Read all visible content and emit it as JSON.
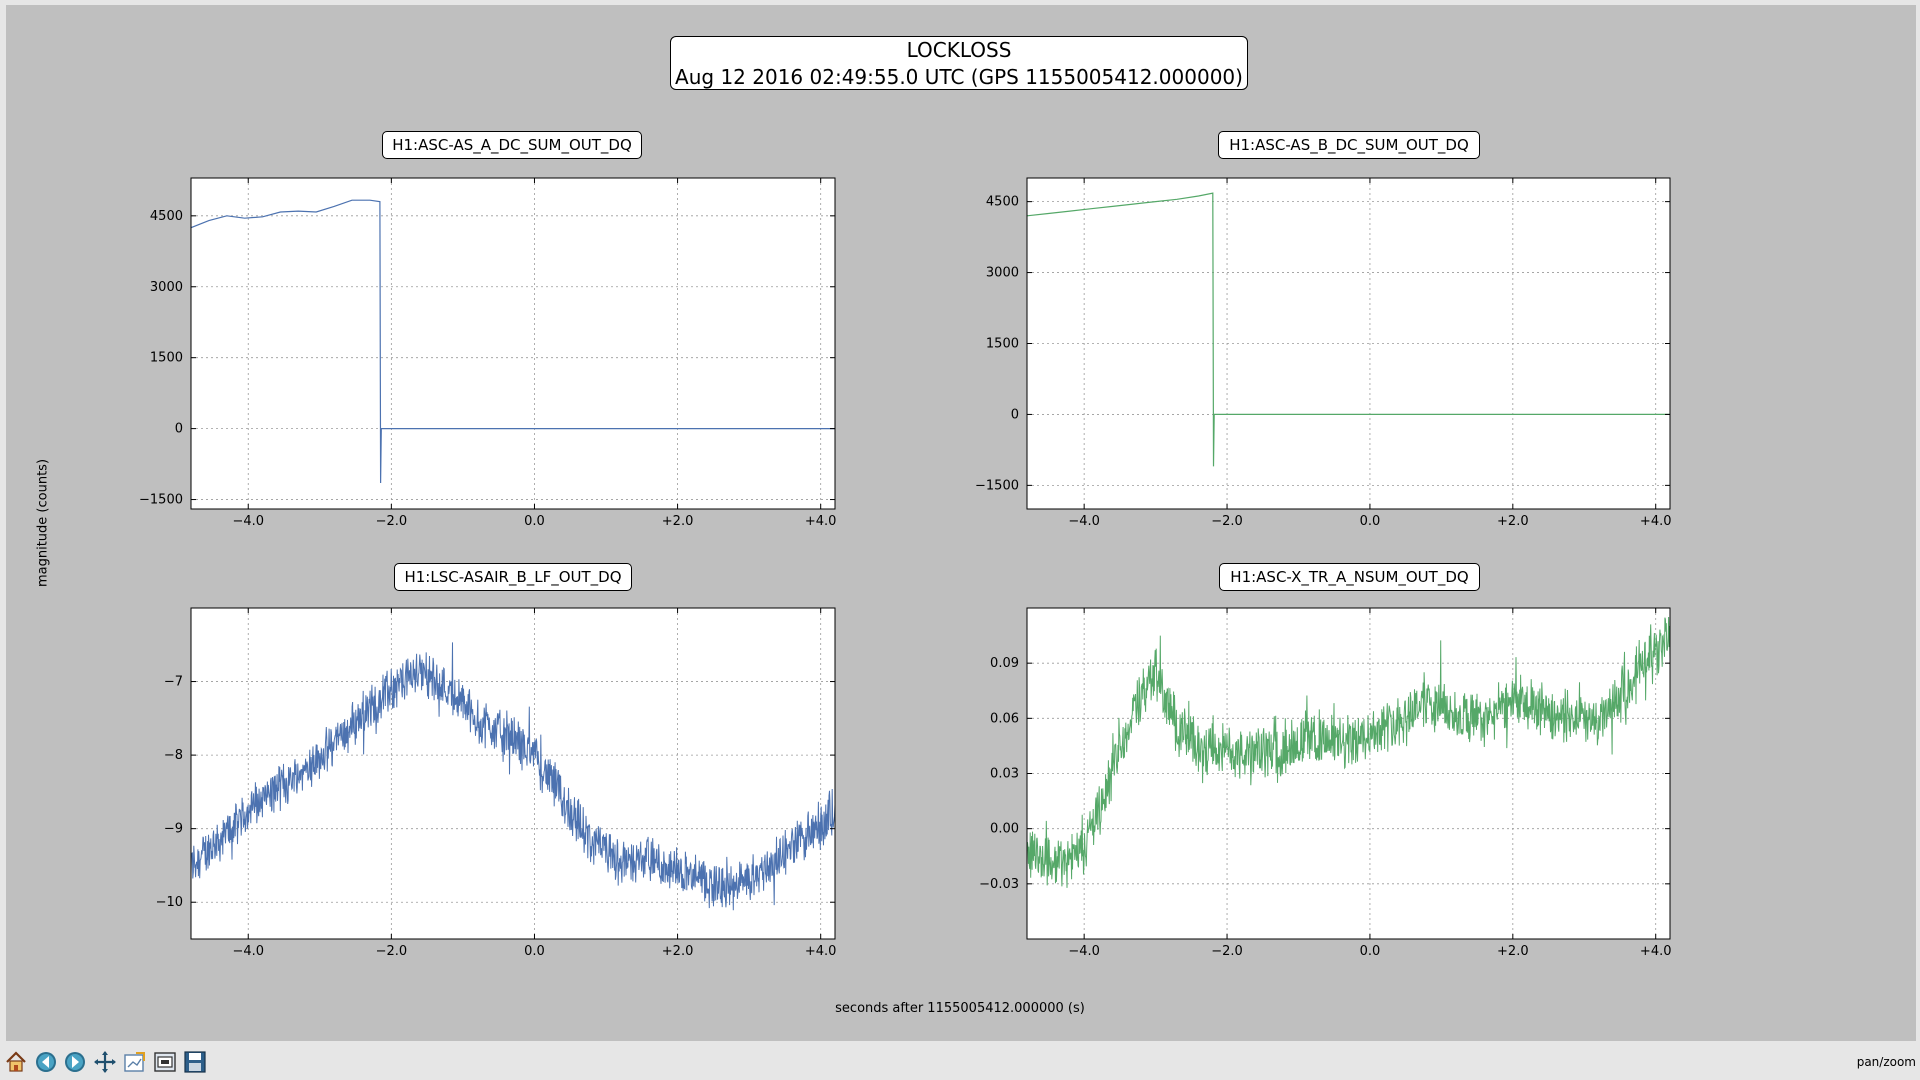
{
  "figure": {
    "title_line1": "LOCKLOSS",
    "title_line2": "Aug 12 2016 02:49:55.0 UTC (GPS 1155005412.000000)",
    "ylabel": "magnitude (counts)",
    "xlabel": "seconds after 1155005412.000000 (s)"
  },
  "toolbar": {
    "buttons": [
      {
        "icon": "home-icon"
      },
      {
        "icon": "back-arrow-icon"
      },
      {
        "icon": "forward-arrow-icon"
      },
      {
        "icon": "pan-icon"
      },
      {
        "icon": "subplots-config-icon"
      },
      {
        "icon": "zoom-rect-icon"
      },
      {
        "icon": "save-icon"
      }
    ],
    "message": "pan/zoom"
  },
  "colors": {
    "blue": "#4c72b0",
    "green": "#55a868",
    "figure_bg": "#bfbfbf",
    "axes_bg": "#ffffff"
  },
  "chart_data": [
    {
      "type": "line",
      "title": "H1:ASC-AS_A_DC_SUM_OUT_DQ",
      "color": "#4c72b0",
      "xlim": [
        -4.8,
        4.2
      ],
      "ylim": [
        -1700,
        5300
      ],
      "xticks": [
        -4,
        -2,
        0,
        2,
        4
      ],
      "xtick_labels": [
        "−4.0",
        "−2.0",
        "0.0",
        "+2.0",
        "+4.0"
      ],
      "yticks": [
        -1500,
        0,
        1500,
        3000,
        4500
      ],
      "ytick_labels": [
        "−1500",
        "0",
        "1500",
        "3000",
        "4500"
      ],
      "grid": true,
      "series": [
        {
          "x": [
            -4.8,
            -4.55,
            -4.3,
            -4.05,
            -3.8,
            -3.55,
            -3.3,
            -3.05,
            -2.8,
            -2.55,
            -2.3,
            -2.16,
            -2.15,
            -2.14,
            -2.12,
            4.2
          ],
          "y": [
            4250,
            4400,
            4500,
            4450,
            4480,
            4580,
            4600,
            4580,
            4700,
            4830,
            4830,
            4800,
            -1150,
            0,
            0,
            0
          ]
        }
      ]
    },
    {
      "type": "line",
      "title": "H1:ASC-AS_B_DC_SUM_OUT_DQ",
      "color": "#55a868",
      "xlim": [
        -4.8,
        4.2
      ],
      "ylim": [
        -2000,
        5000
      ],
      "xticks": [
        -4,
        -2,
        0,
        2,
        4
      ],
      "xtick_labels": [
        "−4.0",
        "−2.0",
        "0.0",
        "+2.0",
        "+4.0"
      ],
      "yticks": [
        -1500,
        0,
        1500,
        3000,
        4500
      ],
      "ytick_labels": [
        "−1500",
        "0",
        "1500",
        "3000",
        "4500"
      ],
      "grid": true,
      "series": [
        {
          "x": [
            -4.8,
            -4.5,
            -4.2,
            -3.9,
            -3.6,
            -3.3,
            -3.0,
            -2.7,
            -2.4,
            -2.2,
            -2.19,
            -2.18,
            -2.16,
            4.2
          ],
          "y": [
            4200,
            4250,
            4300,
            4350,
            4400,
            4450,
            4500,
            4550,
            4620,
            4680,
            -1100,
            0,
            0,
            0
          ]
        }
      ]
    },
    {
      "type": "line",
      "title": "H1:LSC-ASAIR_B_LF_OUT_DQ",
      "color": "#4c72b0",
      "xlim": [
        -4.8,
        4.2
      ],
      "ylim": [
        -10.5,
        -6.0
      ],
      "xticks": [
        -4,
        -2,
        0,
        2,
        4
      ],
      "xtick_labels": [
        "−4.0",
        "−2.0",
        "0.0",
        "+2.0",
        "+4.0"
      ],
      "yticks": [
        -10,
        -9,
        -8,
        -7
      ],
      "ytick_labels": [
        "−10",
        "−9",
        "−8",
        "−7"
      ],
      "grid": true,
      "noise_band": 0.6,
      "series": [
        {
          "x": [
            -4.8,
            -4.4,
            -4.0,
            -3.6,
            -3.2,
            -2.8,
            -2.4,
            -2.0,
            -1.6,
            -1.2,
            -0.8,
            -0.4,
            0.0,
            0.4,
            0.8,
            1.2,
            1.6,
            2.0,
            2.4,
            2.8,
            3.2,
            3.6,
            4.0,
            4.2
          ],
          "y": [
            -9.5,
            -9.15,
            -8.75,
            -8.45,
            -8.2,
            -7.85,
            -7.45,
            -7.1,
            -6.85,
            -7.1,
            -7.5,
            -7.7,
            -8.0,
            -8.6,
            -9.2,
            -9.45,
            -9.45,
            -9.55,
            -9.75,
            -9.85,
            -9.55,
            -9.25,
            -8.95,
            -8.75
          ]
        }
      ]
    },
    {
      "type": "line",
      "title": "H1:ASC-X_TR_A_NSUM_OUT_DQ",
      "color": "#55a868",
      "xlim": [
        -4.8,
        4.2
      ],
      "ylim": [
        -0.06,
        0.12
      ],
      "xticks": [
        -4,
        -2,
        0,
        2,
        4
      ],
      "xtick_labels": [
        "−4.0",
        "−2.0",
        "0.0",
        "+2.0",
        "+4.0"
      ],
      "yticks": [
        -0.03,
        0.0,
        0.03,
        0.06,
        0.09
      ],
      "ytick_labels": [
        "−0.03",
        "0.00",
        "0.03",
        "0.06",
        "0.09"
      ],
      "grid": true,
      "noise_band": 0.028,
      "series": [
        {
          "x": [
            -4.8,
            -4.4,
            -4.0,
            -3.6,
            -3.3,
            -3.0,
            -2.7,
            -2.4,
            -2.0,
            -1.6,
            -1.2,
            -0.8,
            -0.4,
            0.0,
            0.4,
            0.8,
            1.2,
            1.6,
            2.0,
            2.4,
            2.8,
            3.2,
            3.5,
            3.8,
            4.2
          ],
          "y": [
            -0.01,
            -0.02,
            -0.01,
            0.03,
            0.065,
            0.085,
            0.055,
            0.045,
            0.042,
            0.04,
            0.045,
            0.05,
            0.045,
            0.052,
            0.06,
            0.07,
            0.062,
            0.058,
            0.07,
            0.065,
            0.06,
            0.058,
            0.07,
            0.09,
            0.105
          ]
        }
      ]
    }
  ]
}
